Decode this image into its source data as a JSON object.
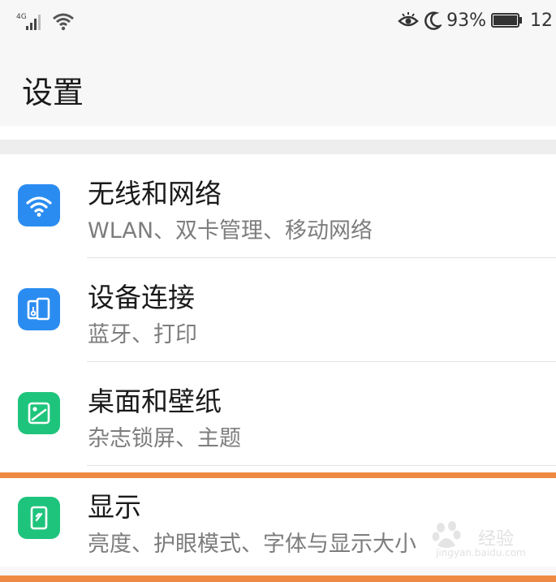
{
  "status_bar": {
    "network_type": "4G",
    "battery_percent": "93%",
    "time_partial": "12",
    "icons": [
      "signal-icon",
      "wifi-icon",
      "eye-comfort-icon",
      "moon-icon",
      "battery-icon"
    ]
  },
  "header": {
    "title": "设置"
  },
  "settings": {
    "items": [
      {
        "title": "无线和网络",
        "subtitle": "WLAN、双卡管理、移动网络",
        "icon": "wifi-icon",
        "icon_color": "#2a8cf0"
      },
      {
        "title": "设备连接",
        "subtitle": "蓝牙、打印",
        "icon": "device-connection-icon",
        "icon_color": "#2a8cf0"
      },
      {
        "title": "桌面和壁纸",
        "subtitle": "杂志锁屏、主题",
        "icon": "wallpaper-icon",
        "icon_color": "#1fc47c"
      },
      {
        "title": "显示",
        "subtitle": "亮度、护眼模式、字体与显示大小",
        "icon": "display-icon",
        "icon_color": "#1fc47c",
        "highlighted": true
      }
    ]
  },
  "highlight_color": "#ee8a43",
  "watermark": {
    "text": "经验",
    "url": "jingyan.baidu.com"
  }
}
